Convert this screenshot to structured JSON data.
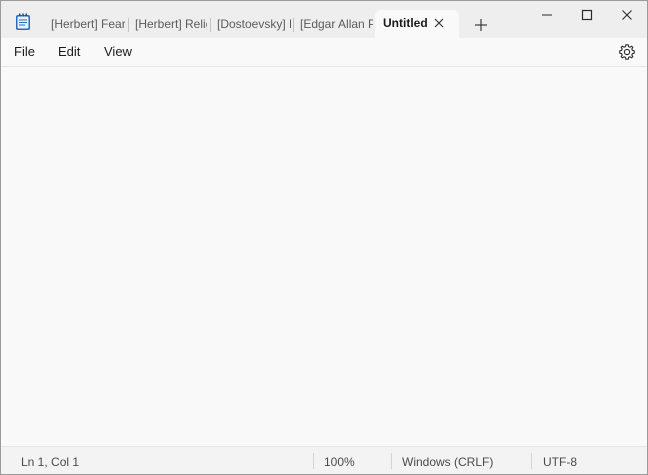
{
  "app": {
    "icon": "notepad-icon"
  },
  "tabs": [
    {
      "label": "[Herbert] Fear.t",
      "active": false
    },
    {
      "label": "[Herbert] Religi",
      "active": false
    },
    {
      "label": "[Dostoevsky] La",
      "active": false
    },
    {
      "label": "[Edgar Allan Pc",
      "active": false
    },
    {
      "label": "Untitled",
      "active": true
    }
  ],
  "menu": {
    "file": "File",
    "edit": "Edit",
    "view": "View"
  },
  "editor": {
    "content": ""
  },
  "status": {
    "position": "Ln 1, Col 1",
    "zoom": "100%",
    "line_ending": "Windows (CRLF)",
    "encoding": "UTF-8"
  },
  "icons": {
    "close_tab": "close-icon",
    "new_tab": "plus-icon",
    "minimize": "minimize-icon",
    "maximize": "maximize-icon",
    "close_window": "close-icon",
    "settings": "gear-icon"
  }
}
